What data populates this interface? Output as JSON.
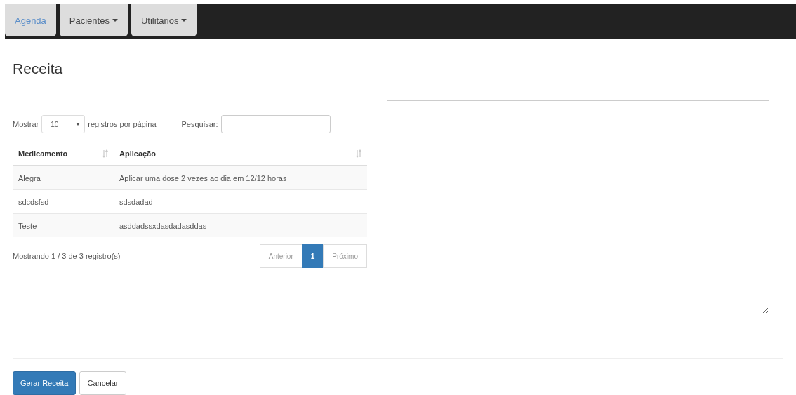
{
  "nav": {
    "tabs": [
      {
        "label": "Agenda",
        "selected": true,
        "dropdown": false
      },
      {
        "label": "Pacientes",
        "selected": false,
        "dropdown": true
      },
      {
        "label": "Utilitarios",
        "selected": false,
        "dropdown": true
      }
    ]
  },
  "page_title": "Receita",
  "table_controls": {
    "show_label": "Mostrar",
    "page_size": "10",
    "per_page_label": "registros por página",
    "search_label": "Pesquisar:"
  },
  "table": {
    "columns": [
      "Medicamento",
      "Aplicação"
    ],
    "rows": [
      [
        "Alegra",
        "Aplicar uma dose 2 vezes ao dia em 12/12 horas"
      ],
      [
        "sdcdsfsd",
        "sdsdadad"
      ],
      [
        "Teste",
        "asddadssxdasdadasddas"
      ]
    ]
  },
  "info": "Mostrando 1 / 3 de 3 registro(s)",
  "pagination": [
    {
      "label": "Anterior",
      "selected": false
    },
    {
      "label": "1",
      "selected": true
    },
    {
      "label": "Próximo",
      "selected": false
    }
  ],
  "buttons": [
    {
      "label": "Gerar Receita",
      "kind": "primary"
    },
    {
      "label": "Cancelar",
      "kind": "default"
    }
  ]
}
